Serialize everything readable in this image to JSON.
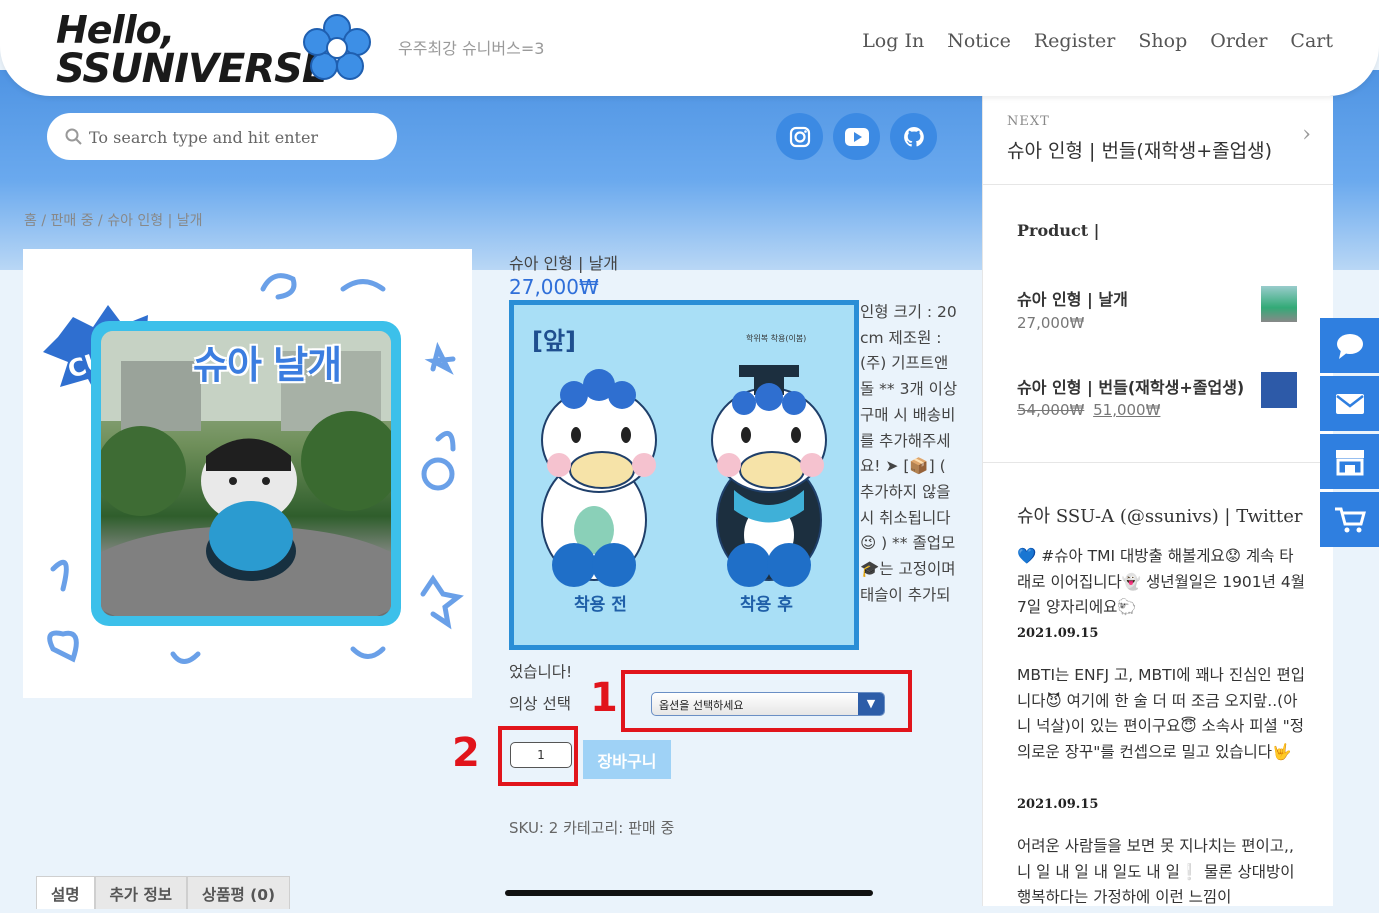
{
  "header": {
    "logo_line1": "Hello,",
    "logo_line2": "SSUNIVERSE",
    "tagline": "우주최강 슈니버스=3",
    "nav": [
      "Log In",
      "Notice",
      "Register",
      "Shop",
      "Order",
      "Cart"
    ]
  },
  "search": {
    "placeholder": "To search type and hit enter"
  },
  "socials": [
    "instagram-icon",
    "youtube-icon",
    "github-icon"
  ],
  "breadcrumb": "홈 / 판매 중 / 슈아 인형 | 날개",
  "product_image": {
    "title": "슈아 날개",
    "badge": "CUTE"
  },
  "product": {
    "title": "슈아 인형 | 날개",
    "price": "27,000₩",
    "detail_front": "[앞]",
    "detail_note": "학위복 착용(이봄)",
    "detail_before": "착용 전",
    "detail_after": "착용 후",
    "description": "인형 크기 : 20cm 제조원 : (주) 기프트앤돌 ** 3개 이상 구매 시 배송비를 추가해주세요! ➤ [📦] ( 추가하지 않을 시 취소됩니다😉 ) ** 졸업모🎓는 고정이며 태슬이 추가되",
    "description_tail": "었습니다!",
    "option_label": "의상 선택",
    "option_placeholder": "옵션을 선택하세요",
    "quantity": "1",
    "cart_button": "장바구니",
    "meta": "SKU: 2 카테고리: 판매 중",
    "annotations": [
      "1",
      "2"
    ]
  },
  "tabs": [
    "설명",
    "추가 정보",
    "상품평 (0)"
  ],
  "sidebar": {
    "next_label": "NEXT",
    "next_title": "슈아 인형 | 번들(재학생+졸업생)",
    "products_heading": "Product |",
    "products": [
      {
        "name": "슈아 인형 | 날개",
        "price": "27,000₩",
        "old_price": ""
      },
      {
        "name": "슈아 인형 | 번들(재학생+졸업생)",
        "price": "51,000₩",
        "old_price": "54,000₩"
      }
    ],
    "twitter_title": "슈아 SSU-A (@ssunivs) | Twitter",
    "tweets": [
      {
        "text": "💙 #슈아 TMI 대방출 해볼게요😟 계속 타래로 이어집니다👻 생년월일은 1901년 4월 7일 양자리에요🐑",
        "date": "2021.09.15"
      },
      {
        "text": "MBTI는 ENFJ 고, MBTI에 꽤나 진심인 편입니다😈 여기에 한 술 더 떠 조금 오지랖..(아니 넉살)이 있는 편이구요😇 소속사 피셜 \"정의로운 장꾸\"를 컨셉으로 밀고 있습니다🤟",
        "date": "2021.09.15"
      },
      {
        "text": "어려운 사람들을 보면 못 지나치는 편이고,, 니 일 내 일 내 일도 내 일❕ 물론 상대방이 행복하다는 가정하에 이런 느낌이",
        "date": ""
      }
    ]
  },
  "floating": [
    "chat-icon",
    "mail-icon",
    "store-icon",
    "cart-icon"
  ],
  "colors": {
    "accent": "#3c8ae3",
    "annotation": "#e1141b",
    "price": "#2f6fd9"
  }
}
